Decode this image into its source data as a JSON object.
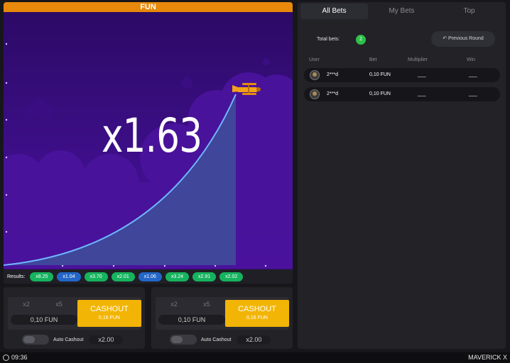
{
  "game": {
    "mode_label": "FUN",
    "multiplier": "x1.63",
    "results_label": "Results:",
    "results": [
      {
        "value": "x8.25",
        "color": "#16b35e"
      },
      {
        "value": "x1.04",
        "color": "#2366c7"
      },
      {
        "value": "x3.70",
        "color": "#16b35e"
      },
      {
        "value": "x2.01",
        "color": "#16b35e"
      },
      {
        "value": "x1.06",
        "color": "#2366c7"
      },
      {
        "value": "x3.24",
        "color": "#16b35e"
      },
      {
        "value": "x2.91",
        "color": "#16b35e"
      },
      {
        "value": "x2.02",
        "color": "#16b35e"
      }
    ]
  },
  "bet_panels": [
    {
      "x2_label": "x2",
      "x5_label": "x5",
      "amount": "0,10 FUN",
      "cashout_label": "CASHOUT",
      "cashout_amount": "0,16 FUN",
      "auto_label": "Auto Cashout",
      "auto_value": "x2.00"
    },
    {
      "x2_label": "x2",
      "x5_label": "x5",
      "amount": "0,10 FUN",
      "cashout_label": "CASHOUT",
      "cashout_amount": "0,16 FUN",
      "auto_label": "Auto Cashout",
      "auto_value": "x2.00"
    }
  ],
  "sidebar": {
    "tabs": [
      "All Bets",
      "My Bets",
      "Top"
    ],
    "active_tab": "All Bets",
    "total_label": "Total bets:",
    "total_count": "2",
    "prev_round_label": "Previous Round",
    "columns": [
      "User",
      "Bet",
      "Multiplier",
      "Win"
    ],
    "rows": [
      {
        "user": "2***d",
        "bet": "0,10 FUN",
        "multiplier": "___",
        "win": "___"
      },
      {
        "user": "2***d",
        "bet": "0,10 FUN",
        "multiplier": "___",
        "win": "___"
      }
    ]
  },
  "footer": {
    "time": "09:36",
    "brand": "MAVERICK X"
  },
  "colors": {
    "accent_orange": "#e8890b",
    "cashout_yellow": "#f2b505",
    "win_green": "#16b35e",
    "low_blue": "#2366c7",
    "sky_purple": "#3a0e7a"
  }
}
